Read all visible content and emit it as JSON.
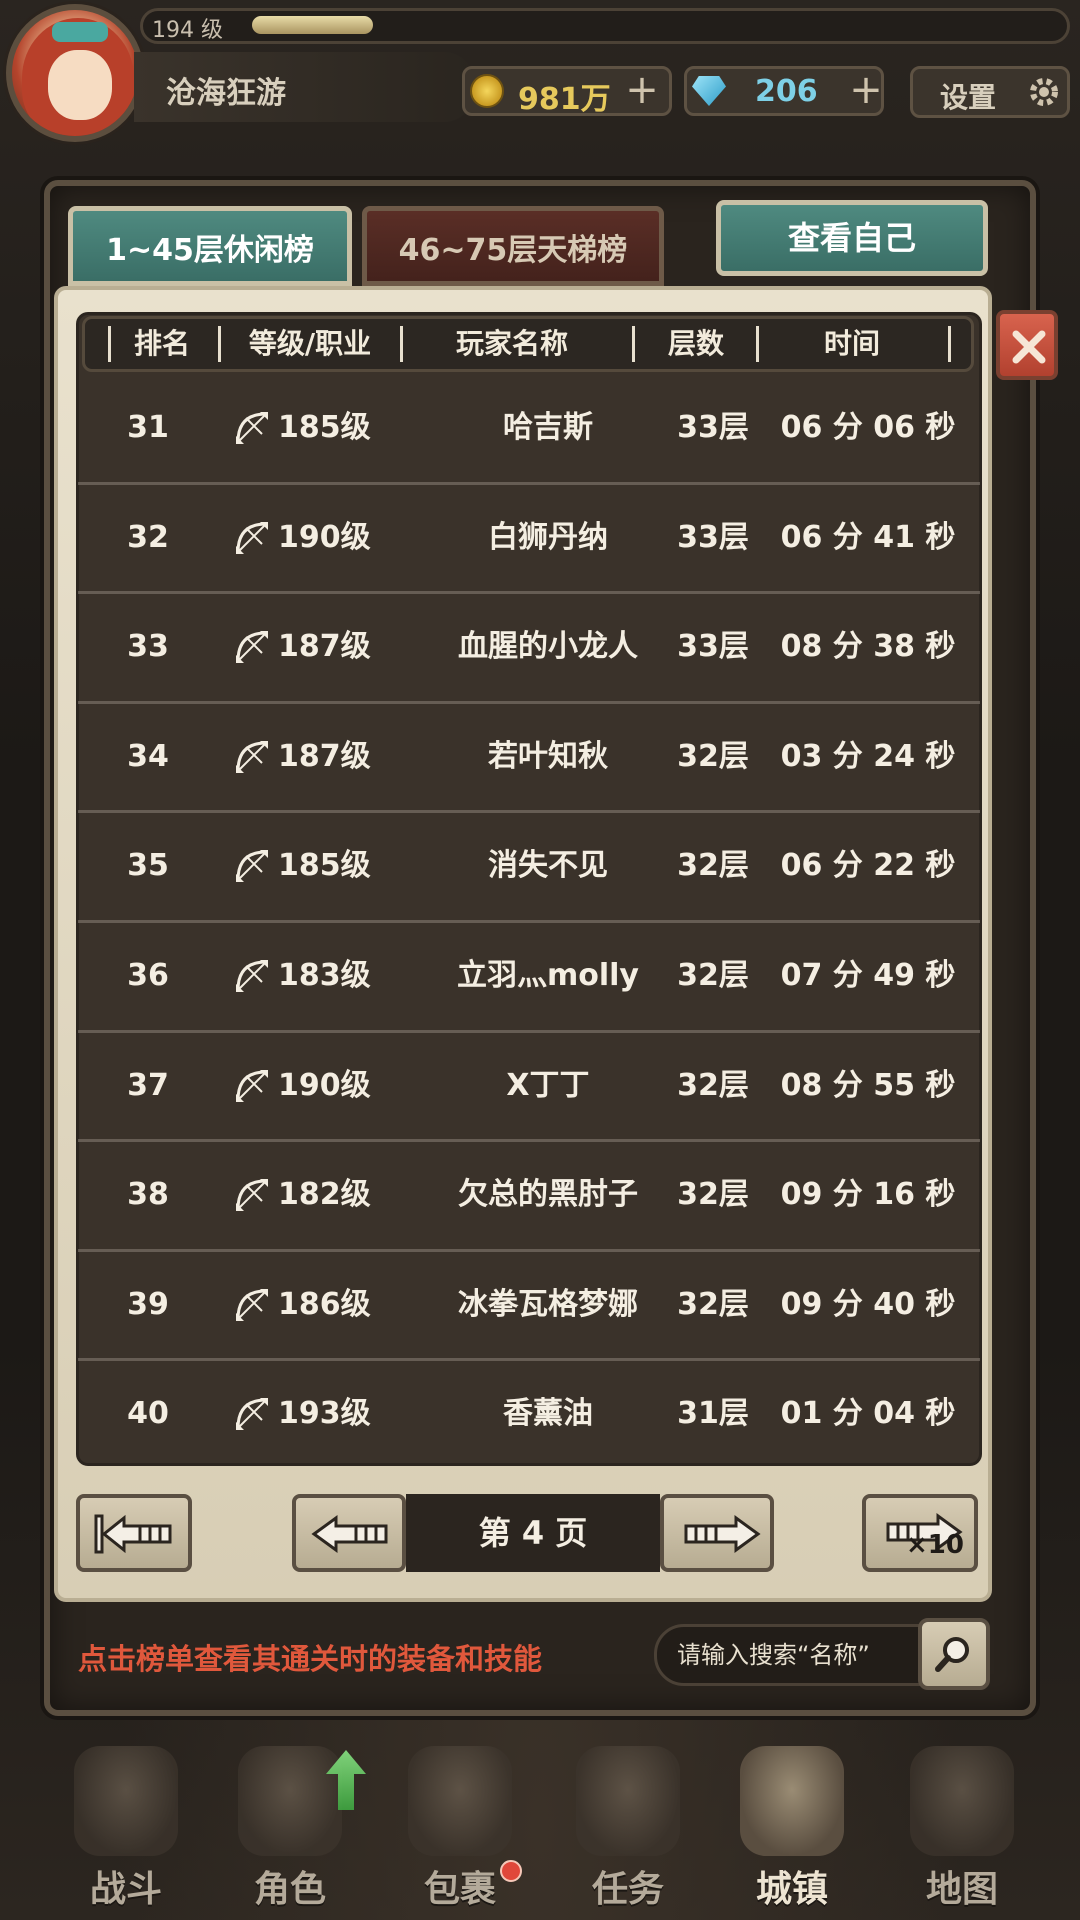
{
  "header": {
    "level": "194 级",
    "player_name": "沧海狂游",
    "xp_fraction": 0.13,
    "gold": "981万",
    "gems": "206",
    "settings_label": "设置"
  },
  "tabs": {
    "casual": "1~45层休闲榜",
    "ladder": "46~75层天梯榜",
    "view_self": "查看自己"
  },
  "table": {
    "headers": [
      "排名",
      "等级/职业",
      "玩家名称",
      "层数",
      "时间"
    ],
    "rows": [
      {
        "rank": "31",
        "level": "185级",
        "name": "哈吉斯",
        "floor": "33层",
        "time": "06 分 06 秒"
      },
      {
        "rank": "32",
        "level": "190级",
        "name": "白狮丹纳",
        "floor": "33层",
        "time": "06 分 41 秒"
      },
      {
        "rank": "33",
        "level": "187级",
        "name": "血腥的小龙人",
        "floor": "33层",
        "time": "08 分 38 秒"
      },
      {
        "rank": "34",
        "level": "187级",
        "name": "若叶知秋",
        "floor": "32层",
        "time": "03 分 24 秒"
      },
      {
        "rank": "35",
        "level": "185级",
        "name": "消失不见",
        "floor": "32层",
        "time": "06 分 22 秒"
      },
      {
        "rank": "36",
        "level": "183级",
        "name": "立羽灬molly",
        "floor": "32层",
        "time": "07 分 49 秒"
      },
      {
        "rank": "37",
        "level": "190级",
        "name": "X丁丁",
        "floor": "32层",
        "time": "08 分 55 秒"
      },
      {
        "rank": "38",
        "level": "182级",
        "name": "欠总的黑肘子",
        "floor": "32层",
        "time": "09 分 16 秒"
      },
      {
        "rank": "39",
        "level": "186级",
        "name": "冰拳瓦格梦娜",
        "floor": "32层",
        "time": "09 分 40 秒"
      },
      {
        "rank": "40",
        "level": "193级",
        "name": "香薰油",
        "floor": "31层",
        "time": "01 分 04 秒"
      }
    ],
    "class_icon": "bow-icon"
  },
  "pager": {
    "page_label": "第 4 页",
    "jump_label": "×10"
  },
  "footer": {
    "hint": "点击榜单查看其通关时的装备和技能",
    "search_placeholder": "请输入搜索“名称”"
  },
  "nav": [
    "战斗",
    "角色",
    "包裹",
    "任务",
    "城镇",
    "地图"
  ],
  "colors": {
    "accent_teal": "#3a6e66",
    "hint_red": "#e0583c",
    "gold": "#e6c95c",
    "gem": "#7ed0e6"
  }
}
